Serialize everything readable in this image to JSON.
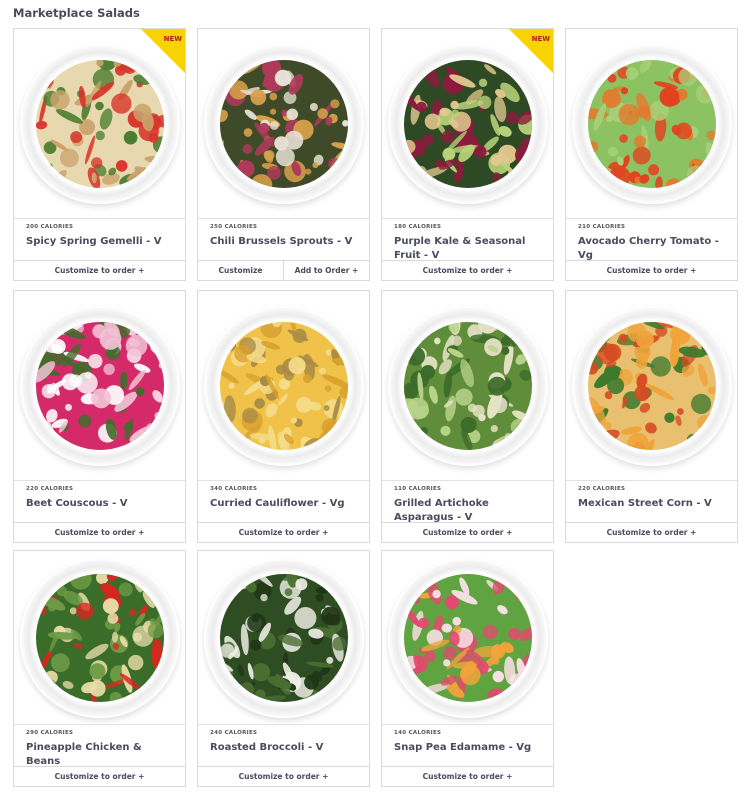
{
  "section": {
    "title": "Marketplace Salads"
  },
  "badge_label": "NEW",
  "salads": [
    {
      "calories": "200 CALORIES",
      "name": "Spicy Spring Gemelli - V",
      "new": true,
      "actions": [
        "Customize to order +"
      ],
      "palette": [
        "#e8d8b0",
        "#4a7c2e",
        "#d8342a",
        "#c9a36b"
      ]
    },
    {
      "calories": "250 CALORIES",
      "name": "Chili Brussels Sprouts - V",
      "new": false,
      "actions": [
        "Customize",
        "Add to Order +"
      ],
      "palette": [
        "#3f4a28",
        "#d8a24a",
        "#e8e2d6",
        "#b03a5a"
      ]
    },
    {
      "calories": "180 CALORIES",
      "name": "Purple Kale & Seasonal Fruit - V",
      "new": true,
      "actions": [
        "Customize to order +"
      ],
      "palette": [
        "#2e4a25",
        "#8c1a3c",
        "#b8d27a",
        "#e3c890"
      ]
    },
    {
      "calories": "210 CALORIES",
      "name": "Avocado Cherry Tomato - Vg",
      "new": false,
      "actions": [
        "Customize to order +"
      ],
      "palette": [
        "#8cc262",
        "#e2431f",
        "#a9d079",
        "#e37a2e"
      ]
    },
    {
      "calories": "220 CALORIES",
      "name": "Beet Couscous - V",
      "new": false,
      "actions": [
        "Customize to order +"
      ],
      "palette": [
        "#d42a6a",
        "#3f6d2b",
        "#f2c2d4",
        "#ffffff"
      ]
    },
    {
      "calories": "340 CALORIES",
      "name": "Curried Cauliflower - Vg",
      "new": false,
      "actions": [
        "Customize to order +"
      ],
      "palette": [
        "#f0c24a",
        "#d9a02e",
        "#a88b45",
        "#f5dc8a"
      ]
    },
    {
      "calories": "110 CALORIES",
      "name": "Grilled Artichoke Asparagus - V",
      "new": false,
      "actions": [
        "Customize to order +"
      ],
      "palette": [
        "#5f8d3a",
        "#b8d48a",
        "#e6e2c6",
        "#3c6a2a"
      ]
    },
    {
      "calories": "220 CALORIES",
      "name": "Mexican Street Corn - V",
      "new": false,
      "actions": [
        "Customize to order +"
      ],
      "palette": [
        "#e8c070",
        "#d64a22",
        "#f0a43a",
        "#3d7a2e"
      ]
    },
    {
      "calories": "290 CALORIES",
      "name": "Pineapple Chicken & Beans",
      "new": false,
      "actions": [
        "Customize to order +"
      ],
      "palette": [
        "#3b6d2a",
        "#d8261f",
        "#e8dca8",
        "#6e9b45"
      ]
    },
    {
      "calories": "240 CALORIES",
      "name": "Roasted Broccoli - V",
      "new": false,
      "actions": [
        "Customize to order +"
      ],
      "palette": [
        "#2f4d22",
        "#4a6f32",
        "#eeeee6",
        "#1f3516"
      ]
    },
    {
      "calories": "140 CALORIES",
      "name": "Snap Pea Edamame - Vg",
      "new": false,
      "actions": [
        "Customize to order +"
      ],
      "palette": [
        "#5fa440",
        "#e24a6e",
        "#f1a43a",
        "#fbe1e8"
      ]
    }
  ]
}
